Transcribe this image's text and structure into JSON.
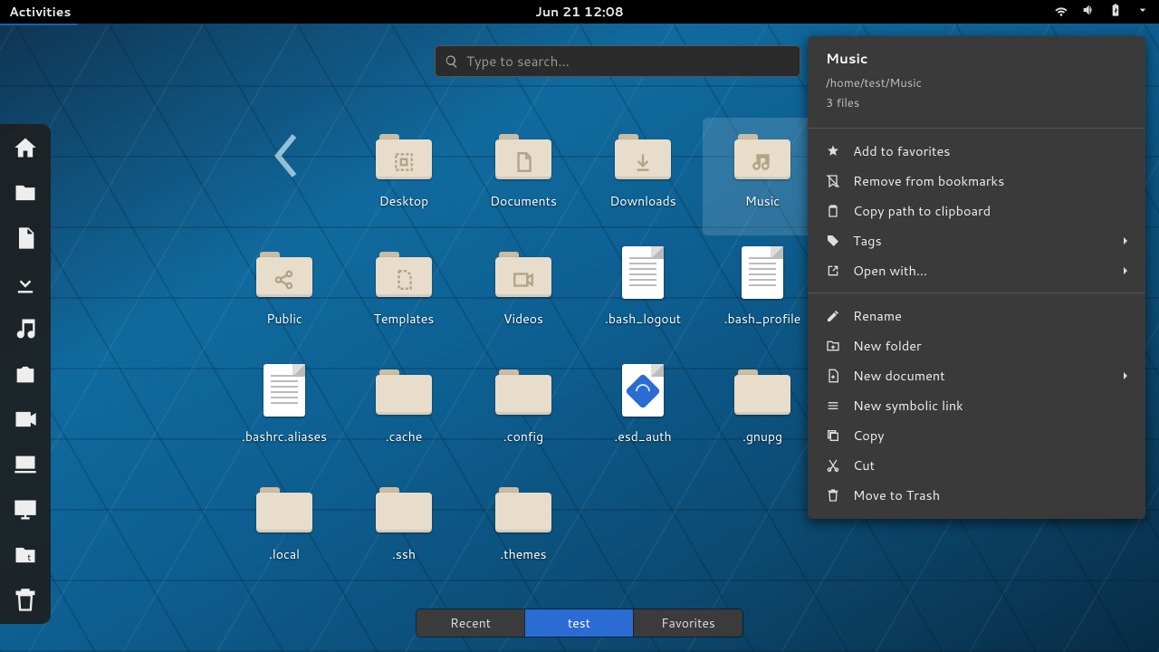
{
  "topbar": {
    "activities": "Activities",
    "datetime": "Jun 21  12:08"
  },
  "search": {
    "placeholder": "Type to search..."
  },
  "dash": [
    {
      "id": "home-icon"
    },
    {
      "id": "files-icon"
    },
    {
      "id": "document-icon"
    },
    {
      "id": "downloads-icon"
    },
    {
      "id": "music-icon"
    },
    {
      "id": "camera-icon"
    },
    {
      "id": "videos-icon"
    },
    {
      "id": "computer-icon"
    },
    {
      "id": "network-icon"
    },
    {
      "id": "templates-icon"
    },
    {
      "id": "trash-icon"
    }
  ],
  "gridSkipFirst": true,
  "grid": [
    {
      "label": "Desktop",
      "icon": "folder",
      "emblem": "desktop"
    },
    {
      "label": "Documents",
      "icon": "folder",
      "emblem": "doc"
    },
    {
      "label": "Downloads",
      "icon": "folder",
      "emblem": "download"
    },
    {
      "label": "Music",
      "icon": "folder",
      "emblem": "music",
      "selected": true
    },
    {
      "label": "Public",
      "icon": "folder",
      "emblem": "share"
    },
    {
      "label": "Templates",
      "icon": "folder",
      "emblem": "template"
    },
    {
      "label": "Videos",
      "icon": "folder",
      "emblem": "video"
    },
    {
      "label": ".bash_logout",
      "icon": "textfile"
    },
    {
      "label": ".bash_profile",
      "icon": "textfile"
    },
    {
      "label": ".bashrc.aliases",
      "icon": "textfile"
    },
    {
      "label": ".cache",
      "icon": "folder"
    },
    {
      "label": ".config",
      "icon": "folder"
    },
    {
      "label": ".esd_auth",
      "icon": "bluefile"
    },
    {
      "label": ".gnupg",
      "icon": "folder"
    },
    {
      "label": ".local",
      "icon": "folder"
    },
    {
      "label": ".ssh",
      "icon": "folder"
    },
    {
      "label": ".themes",
      "icon": "folder"
    }
  ],
  "tabs": [
    {
      "label": "Recent",
      "active": false
    },
    {
      "label": "test",
      "active": true
    },
    {
      "label": "Favorites",
      "active": false
    }
  ],
  "menu": {
    "title": "Music",
    "path": "/home/test/Music",
    "count": "3 files",
    "groups": [
      [
        {
          "icon": "star",
          "label": "Add to favorites"
        },
        {
          "icon": "bookmark-remove",
          "label": "Remove from bookmarks"
        },
        {
          "icon": "clipboard",
          "label": "Copy path to clipboard"
        },
        {
          "icon": "tag",
          "label": "Tags",
          "sub": true
        },
        {
          "icon": "open",
          "label": "Open with...",
          "sub": true
        }
      ],
      [
        {
          "icon": "rename",
          "label": "Rename"
        },
        {
          "icon": "newfolder",
          "label": "New folder"
        },
        {
          "icon": "newdoc",
          "label": "New document",
          "sub": true
        },
        {
          "icon": "symlink",
          "label": "New symbolic link"
        },
        {
          "icon": "copy",
          "label": "Copy"
        },
        {
          "icon": "cut",
          "label": "Cut"
        },
        {
          "icon": "trash",
          "label": "Move to Trash"
        }
      ]
    ]
  }
}
